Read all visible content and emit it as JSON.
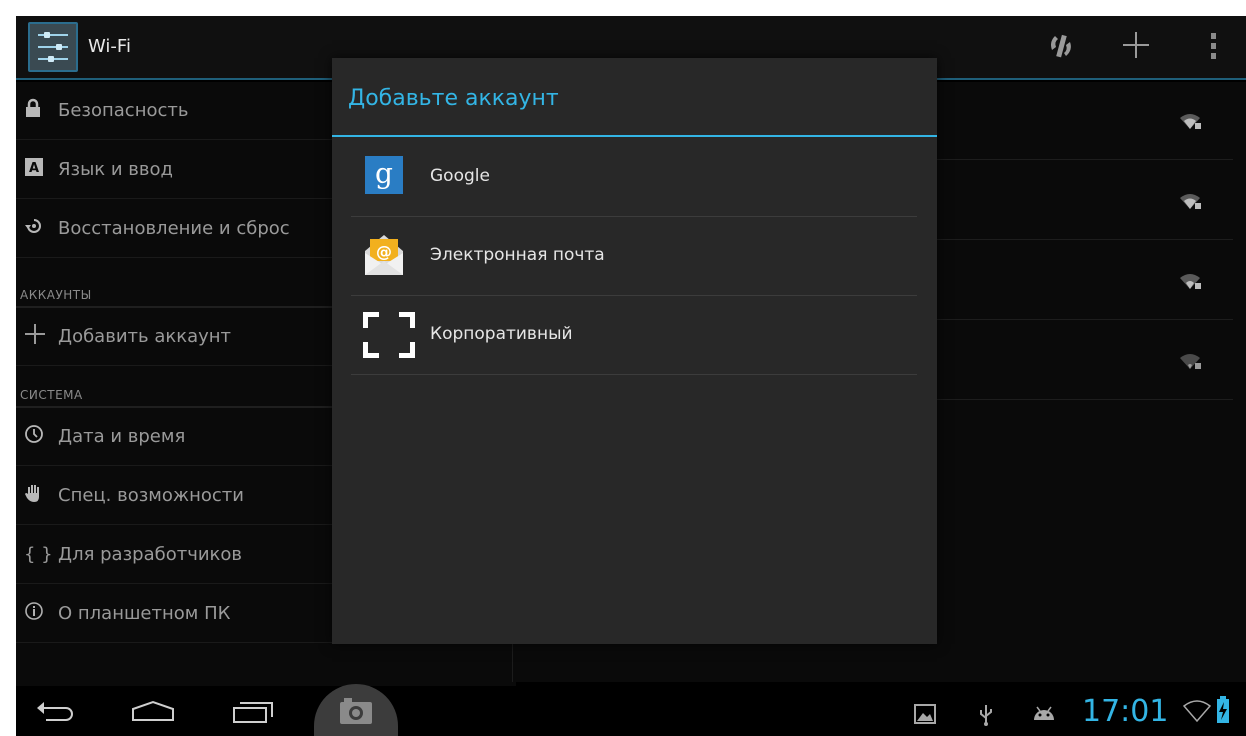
{
  "colors": {
    "accent": "#33b5e5",
    "dialog_bg": "#282828",
    "background": "#000000"
  },
  "action_bar": {
    "title": "Wi-Fi",
    "icon": "settings-sliders-icon",
    "actions": [
      "wps-icon",
      "add-icon",
      "overflow-menu-icon"
    ]
  },
  "sidebar": {
    "items_top": [
      {
        "label": "Безопасность",
        "icon": "lock-icon"
      },
      {
        "label": "Язык и ввод",
        "icon": "keyboard-icon"
      },
      {
        "label": "Восстановление и сброс",
        "icon": "restore-icon"
      }
    ],
    "section_accounts": "АККАУНТЫ",
    "add_account": {
      "label": "Добавить аккаунт",
      "icon": "plus-icon"
    },
    "section_system": "СИСТЕМА",
    "items_system": [
      {
        "label": "Дата и время",
        "icon": "clock-icon"
      },
      {
        "label": "Спец. возможности",
        "icon": "hand-icon"
      },
      {
        "label": "Для разработчиков",
        "icon": "braces-icon"
      },
      {
        "label": "О планшетном ПК",
        "icon": "info-icon"
      }
    ]
  },
  "networks": [
    {
      "icon": "wifi-locked-icon"
    },
    {
      "icon": "wifi-locked-icon"
    },
    {
      "icon": "wifi-locked-icon"
    },
    {
      "icon": "wifi-locked-icon"
    }
  ],
  "dialog": {
    "title": "Добавьте аккаунт",
    "options": [
      {
        "label": "Google",
        "icon": "google-icon",
        "glyph": "g"
      },
      {
        "label": "Электронная почта",
        "icon": "email-icon",
        "glyph": "@"
      },
      {
        "label": "Корпоративный",
        "icon": "corporate-icon"
      }
    ]
  },
  "navbar": {
    "buttons": [
      "back-icon",
      "home-icon",
      "recents-icon",
      "screenshot-camera-icon"
    ],
    "status_icons": [
      "gallery-notification-icon",
      "usb-icon",
      "android-debug-icon"
    ],
    "time": "17:01",
    "indicators": [
      "wifi-status-icon",
      "battery-charging-icon"
    ]
  }
}
